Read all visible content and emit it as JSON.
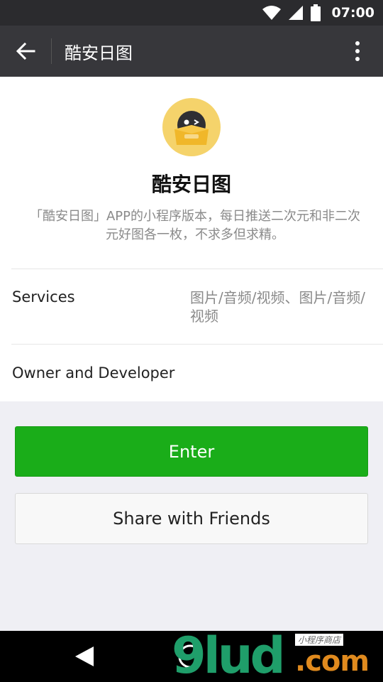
{
  "status_bar": {
    "time": "07:00"
  },
  "title_bar": {
    "title": "酷安日图"
  },
  "app": {
    "name": "酷安日图",
    "description": "「酷安日图」APP的小程序版本，每日推送二次元和非二次元好图各一枚，不求多但求精。"
  },
  "info_rows": {
    "services_label": "Services",
    "services_value": "图片/音频/视频、图片/音频/视频",
    "owner_label": "Owner and Developer"
  },
  "buttons": {
    "enter_label": "Enter",
    "share_label": "Share with Friends"
  },
  "watermark": {
    "main": "9lud",
    "suffix": ".com",
    "small": "小程序商店"
  },
  "colors": {
    "status_bar": "#2b2b2e",
    "title_bar": "#37373b",
    "accent_green": "#1aad19",
    "logo_bg": "#f5d36b",
    "page_bg": "#efeff4"
  },
  "icons": {
    "back": "arrow-left-icon",
    "more": "more-vertical-icon",
    "wifi": "wifi-icon",
    "signal": "signal-icon",
    "battery": "battery-icon",
    "nav_back": "nav-back-icon",
    "nav_home": "nav-home-icon"
  }
}
